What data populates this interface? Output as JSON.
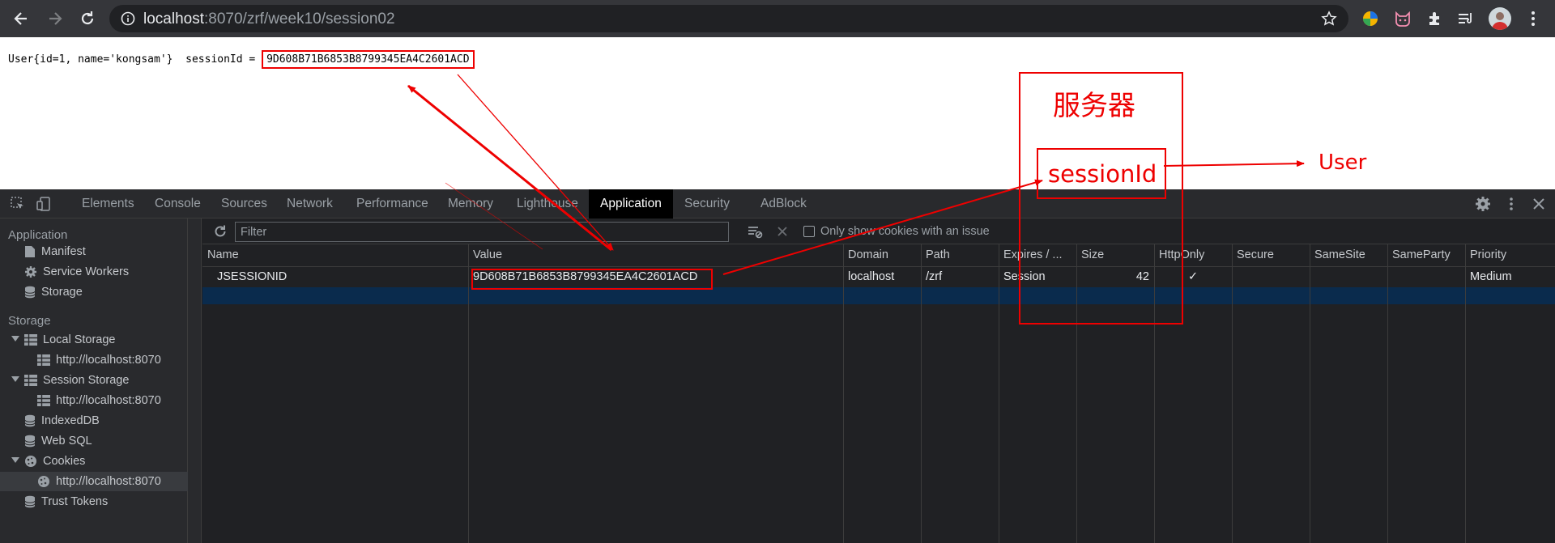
{
  "browser": {
    "url_host": "localhost",
    "url_rest": ":8070/zrf/week10/session02"
  },
  "page": {
    "user_text": "User{id=1, name='kongsam'}  sessionId = ",
    "session_id": "9D608B71B6853B8799345EA4C2601ACD"
  },
  "devtools": {
    "tabs": [
      "Elements",
      "Console",
      "Sources",
      "Network",
      "Performance",
      "Memory",
      "Lighthouse",
      "Application",
      "Security",
      "AdBlock"
    ],
    "active_tab": "Application",
    "sidebar": {
      "application_heading": "Application",
      "application_items": [
        "Manifest",
        "Service Workers",
        "Storage"
      ],
      "storage_heading": "Storage",
      "local_storage": "Local Storage",
      "local_storage_origin": "http://localhost:8070",
      "session_storage": "Session Storage",
      "session_storage_origin": "http://localhost:8070",
      "indexeddb": "IndexedDB",
      "websql": "Web SQL",
      "cookies": "Cookies",
      "cookies_origin": "http://localhost:8070",
      "trust_tokens": "Trust Tokens"
    },
    "toolbar": {
      "filter_placeholder": "Filter",
      "only_issue_label": "Only show cookies with an issue"
    },
    "table": {
      "headers": [
        "Name",
        "Value",
        "Domain",
        "Path",
        "Expires / ...",
        "Size",
        "HttpOnly",
        "Secure",
        "SameSite",
        "SameParty",
        "Priority"
      ],
      "rows": [
        {
          "name": "JSESSIONID",
          "value": "9D608B71B6853B8799345EA4C2601ACD",
          "domain": "localhost",
          "path": "/zrf",
          "expires": "Session",
          "size": "42",
          "httponly": "✓",
          "secure": "",
          "samesite": "",
          "sameparty": "",
          "priority": "Medium"
        }
      ]
    }
  },
  "annotations": {
    "server_label": "服务器",
    "session_label": "sessionId",
    "user_label": "User",
    "color": "#ee0000"
  }
}
